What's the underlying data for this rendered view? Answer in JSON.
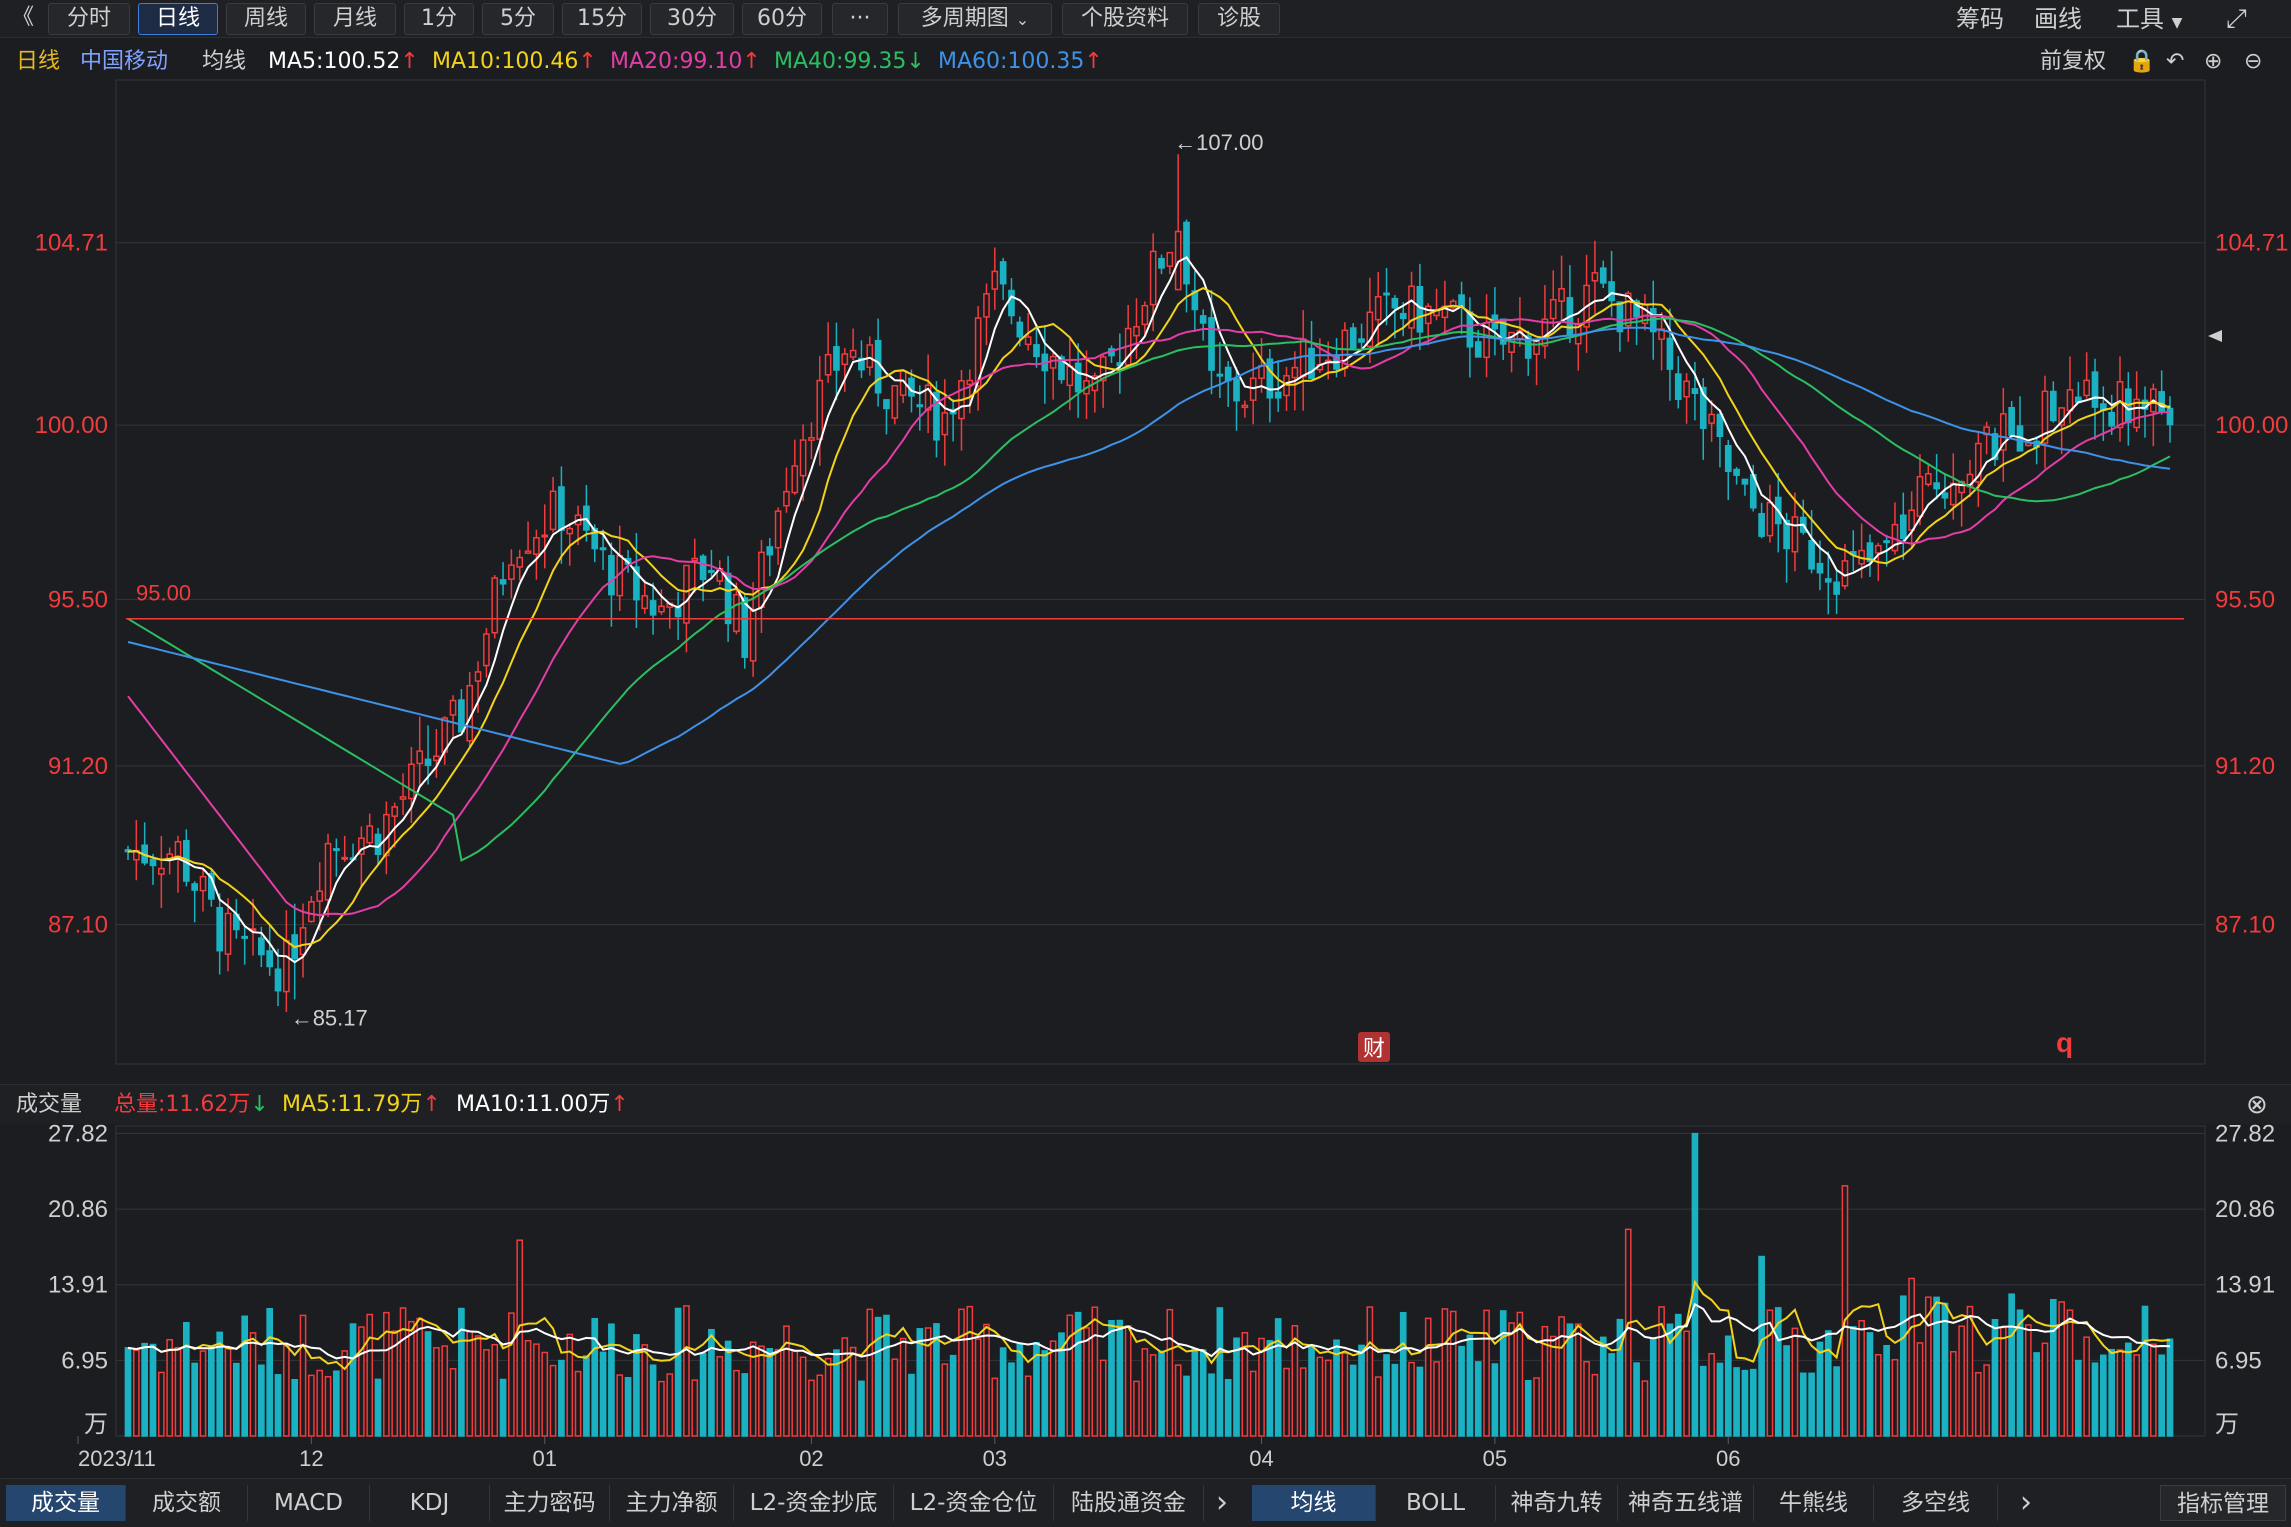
{
  "toolbar": {
    "back_glyph": "《",
    "periods": [
      "分时",
      "日线",
      "周线",
      "月线",
      "1分",
      "5分",
      "15分",
      "30分",
      "60分"
    ],
    "active_period": "日线",
    "more_glyph": "···",
    "multi_period": "多周期图",
    "stock_info": "个股资料",
    "diagnose": "诊股",
    "chips": "筹码",
    "draw": "画线",
    "tools": "工具",
    "fullscreen_icon": "fullscreen-icon"
  },
  "legend": {
    "period": "日线",
    "stock_name": "中国移动",
    "ma_label": "均线",
    "ma5": "MA5:100.52",
    "ma10": "MA10:100.46",
    "ma20": "MA20:99.10",
    "ma40": "MA40:99.35",
    "ma60": "MA60:100.35",
    "adjust": "前复权",
    "arrows": [
      "↑",
      "↑",
      "↑",
      "↓",
      "↑"
    ]
  },
  "volume_legend": {
    "title": "成交量",
    "total": "总量:11.62万",
    "ma5": "MA5:11.79万",
    "ma10": "MA10:11.00万",
    "arrows": [
      "↓",
      "↑",
      "↑"
    ]
  },
  "colors": {
    "up": "#f03c3c",
    "down": "#1ab2c2",
    "ma5": "#ffffff",
    "ma10": "#f2d31c",
    "ma20": "#e23ea6",
    "ma40": "#2bbf62",
    "ma60": "#3e92e8",
    "price_axis": "#f03c3c",
    "support_line": "#f03c3c"
  },
  "price_axis": {
    "ticks": [
      "104.71",
      "100.00",
      "95.50",
      "91.20",
      "87.10"
    ]
  },
  "annotations": {
    "high": "←107.00",
    "low": "←85.17",
    "support": "95.00",
    "event_badge": "财",
    "marker": "q"
  },
  "volume_axis": {
    "ticks": [
      "27.82",
      "20.86",
      "13.91",
      "6.95"
    ],
    "unit": "万"
  },
  "x_axis": {
    "labels": [
      "2023/11",
      "12",
      "01",
      "02",
      "03",
      "04",
      "05",
      "06"
    ]
  },
  "bottom_tabs": {
    "left": [
      "成交量",
      "成交额",
      "MACD",
      "KDJ",
      "主力密码",
      "主力净额",
      "L2-资金抄底",
      "L2-资金仓位",
      "陆股通资金"
    ],
    "right": [
      "均线",
      "BOLL",
      "神奇九转",
      "神奇五线谱",
      "牛熊线",
      "多空线"
    ],
    "indicator_mgmt": "指标管理",
    "more_glyph": "›"
  },
  "chart_data": {
    "type": "candlestick",
    "y_range": [
      83.5,
      108.5
    ],
    "volume_range": [
      0,
      28.5
    ],
    "volume_unit": "万",
    "support_level": 95.0,
    "high_point": 107.0,
    "low_point": 85.17,
    "moving_averages": [
      "MA5",
      "MA10",
      "MA20",
      "MA40",
      "MA60"
    ]
  }
}
